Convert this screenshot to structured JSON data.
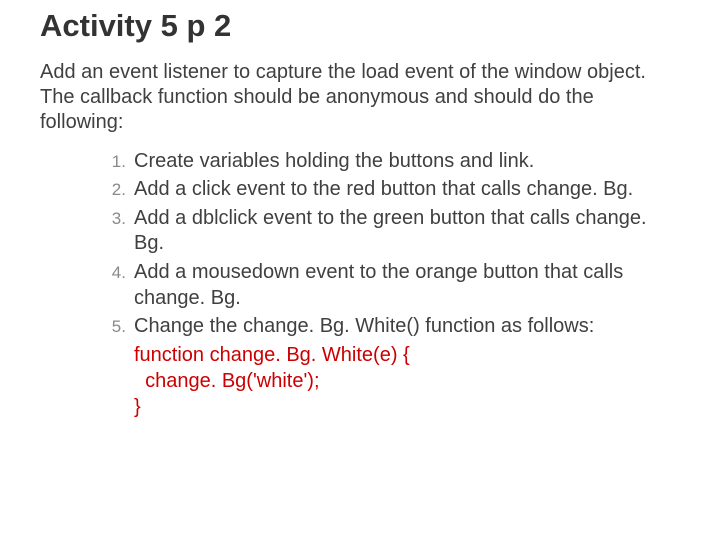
{
  "title": "Activity 5 p 2",
  "intro": "Add an event listener to capture the load event of the window object. The callback function should be anonymous and should do the following:",
  "steps": [
    "Create variables holding the buttons and link.",
    "Add a click event to the red button that calls change. Bg.",
    "Add a dblclick event to the green button that calls change. Bg.",
    "Add a mousedown event to the orange button that calls change. Bg.",
    "Change the change. Bg. White() function as follows:"
  ],
  "code": {
    "l1": "function change. Bg. White(e) {",
    "l2": "  change. Bg('white');",
    "l3": "}"
  }
}
